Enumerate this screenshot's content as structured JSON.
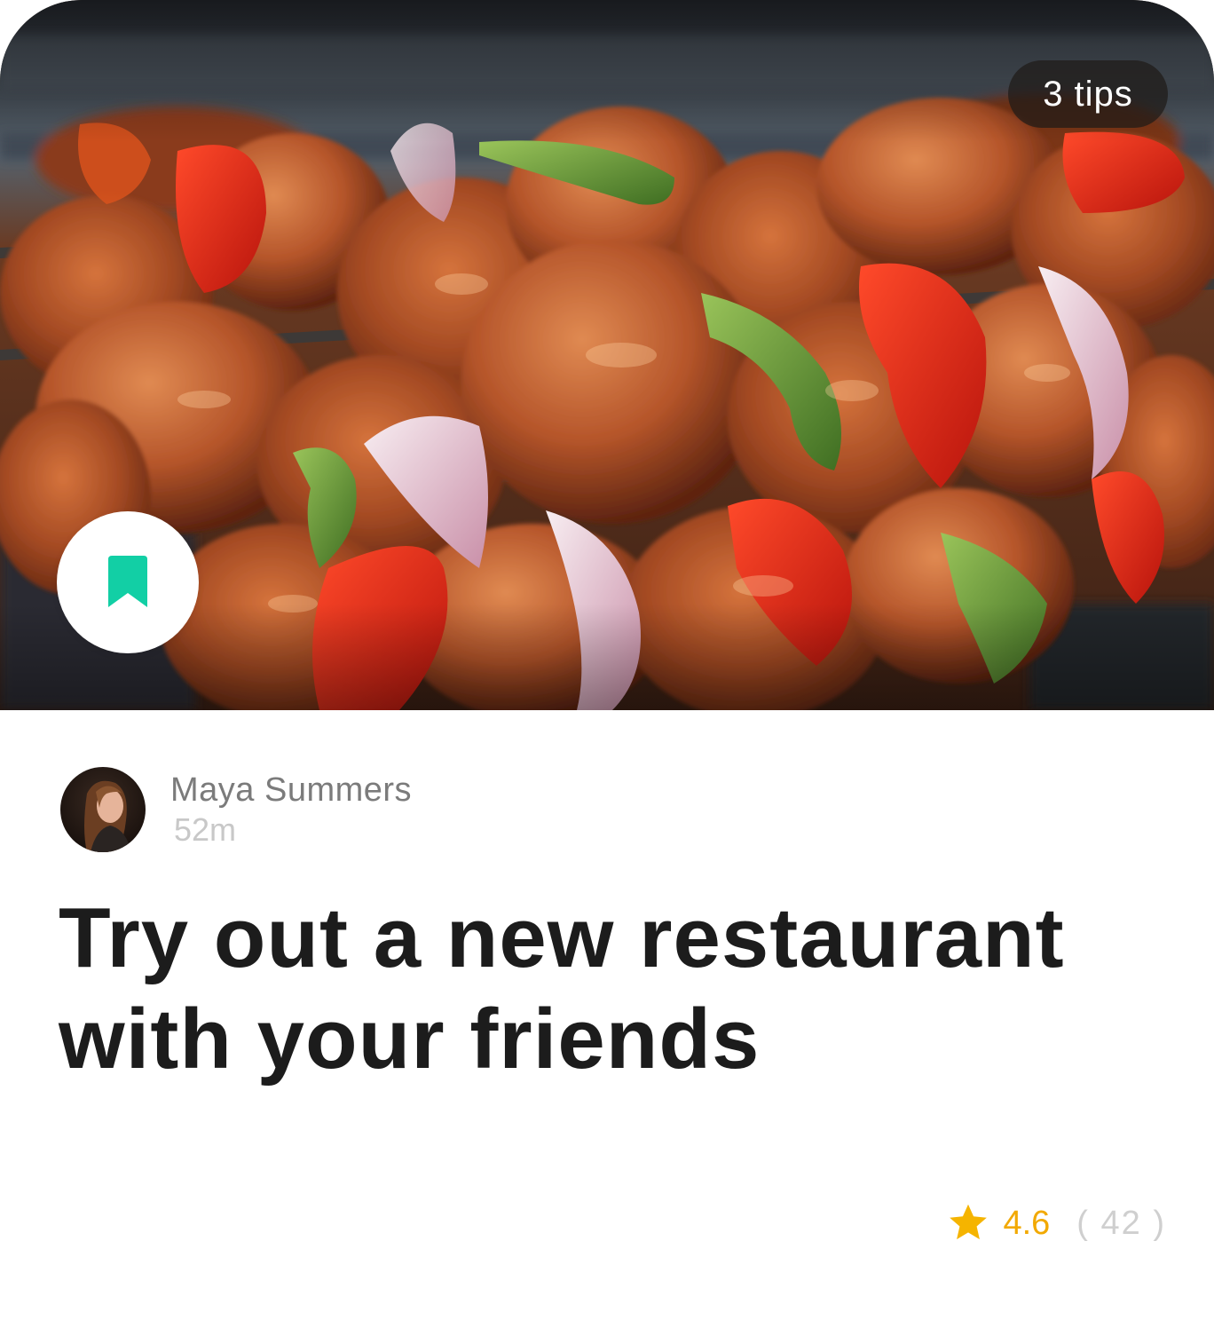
{
  "card": {
    "badge_text": "3 tips",
    "hero_image": "grilled kebab skewers with peppers and onions",
    "bookmark_icon": "bookmark-icon",
    "author": {
      "name": "Maya Summers",
      "time": "52m",
      "avatar": "avatar-photo"
    },
    "title": "Try out a new restaurant with your friends",
    "rating": {
      "icon": "star-icon",
      "value": "4.6",
      "count": "( 42 )"
    }
  },
  "colors": {
    "bookmark": "#12cfa5",
    "star": "#f5b400",
    "rating_value": "#f2a900",
    "title": "#1c1c1c",
    "author_name": "#7b7b7b",
    "time": "#c8c8c8",
    "count": "#cfcfcf"
  }
}
